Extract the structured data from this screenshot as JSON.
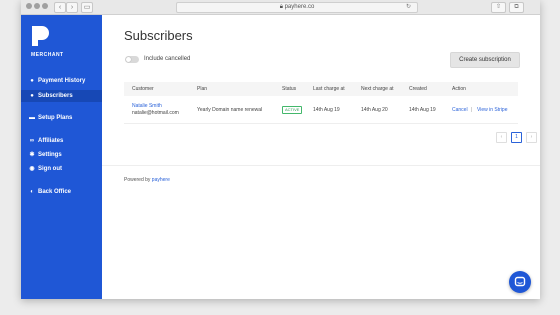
{
  "browser": {
    "url": "payhere.co",
    "nav_back": "‹",
    "nav_forward": "›",
    "sidebar_toggle": "▭",
    "share": "⇧",
    "tabs": "⧉"
  },
  "sidebar": {
    "brand": "MERCHANT",
    "items": [
      {
        "label": "Payment History",
        "icon": "dollar-icon",
        "glyph": "●",
        "active": false
      },
      {
        "label": "Subscribers",
        "icon": "user-icon",
        "glyph": "●",
        "active": true
      },
      {
        "label": "Setup Plans",
        "icon": "plans-icon",
        "glyph": "▬",
        "active": false
      },
      {
        "label": "Affiliates",
        "icon": "link-icon",
        "glyph": "∞",
        "active": false
      },
      {
        "label": "Settings",
        "icon": "gear-icon",
        "glyph": "✱",
        "active": false
      },
      {
        "label": "Sign out",
        "icon": "sign-out-icon",
        "glyph": "◉",
        "active": false
      },
      {
        "label": "Back Office",
        "icon": "back-office-icon",
        "glyph": "◐",
        "active": false
      }
    ]
  },
  "main": {
    "title": "Subscribers",
    "toggle_label": "Include cancelled",
    "create_button": "Create subscription",
    "table": {
      "headers": [
        "Customer",
        "Plan",
        "Status",
        "Last charge at",
        "Next charge at",
        "Created",
        "Action"
      ],
      "rows": [
        {
          "customer_name": "Natalie Smith",
          "customer_email": "natalie@hotmail.com",
          "plan": "Yearly Domain name renewal",
          "status": "ACTIVE",
          "last_charge": "14th Aug 19",
          "next_charge": "14th Aug 20",
          "created": "14th Aug 19",
          "action_cancel": "Cancel",
          "action_sep": "|",
          "action_view": "View in Stripe"
        }
      ]
    },
    "pager": {
      "prev": "‹",
      "current": "1",
      "next": "›"
    },
    "footer_prefix": "Powered by",
    "footer_link": "payhere"
  },
  "colors": {
    "sidebar": "#1f57d6",
    "link": "#2a62d9",
    "active_badge": "#43b86b"
  }
}
